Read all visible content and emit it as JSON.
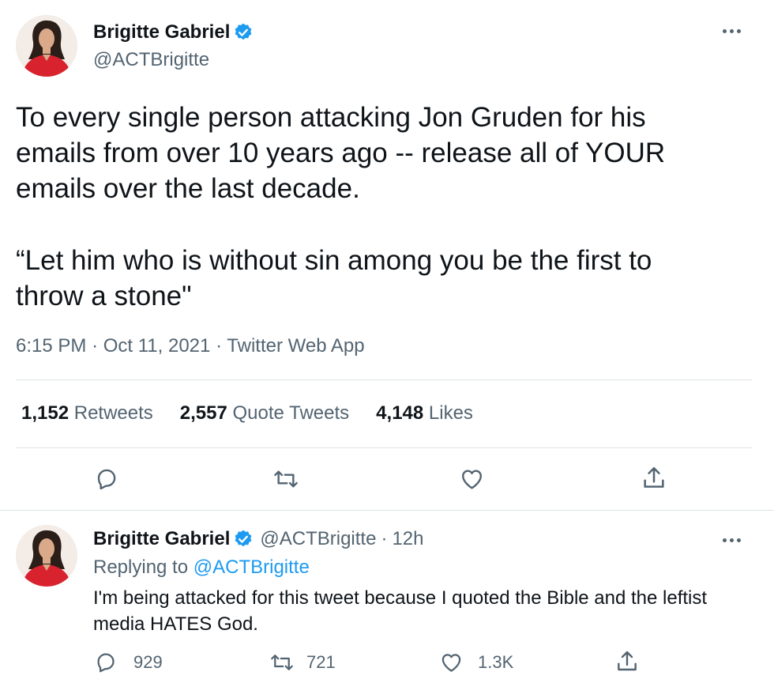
{
  "main_tweet": {
    "author": {
      "name": "Brigitte Gabriel",
      "handle": "@ACTBrigitte",
      "verified": true
    },
    "text_lines": [
      "To every single person attacking Jon Gruden for his emails from over 10 years ago -- release all of YOUR emails over the last decade.",
      "“Let him who is without sin among you be the first to throw a stone\""
    ],
    "time": "6:15 PM",
    "date": "Oct 11, 2021",
    "source": "Twitter Web App",
    "separator": "·",
    "stats": [
      {
        "count": "1,152",
        "label": "Retweets"
      },
      {
        "count": "2,557",
        "label": "Quote Tweets"
      },
      {
        "count": "4,148",
        "label": "Likes"
      }
    ],
    "actions": [
      "reply-icon",
      "retweet-icon",
      "like-icon",
      "share-icon"
    ]
  },
  "reply_tweet": {
    "author": {
      "name": "Brigitte Gabriel",
      "handle": "@ACTBrigitte",
      "verified": true
    },
    "age": "12h",
    "separator": "·",
    "replying_prefix": "Replying to",
    "replying_handle": "@ACTBrigitte",
    "text": "I'm being attacked for this tweet because I quoted the Bible and the leftist media HATES God.",
    "counts": {
      "replies": "929",
      "retweets": "721",
      "likes": "1.3K"
    }
  },
  "colors": {
    "text": "#0f1419",
    "secondary": "#536471",
    "accent": "#1d9bf0",
    "divider": "#dfe5e8",
    "dress": "#d8232f"
  }
}
